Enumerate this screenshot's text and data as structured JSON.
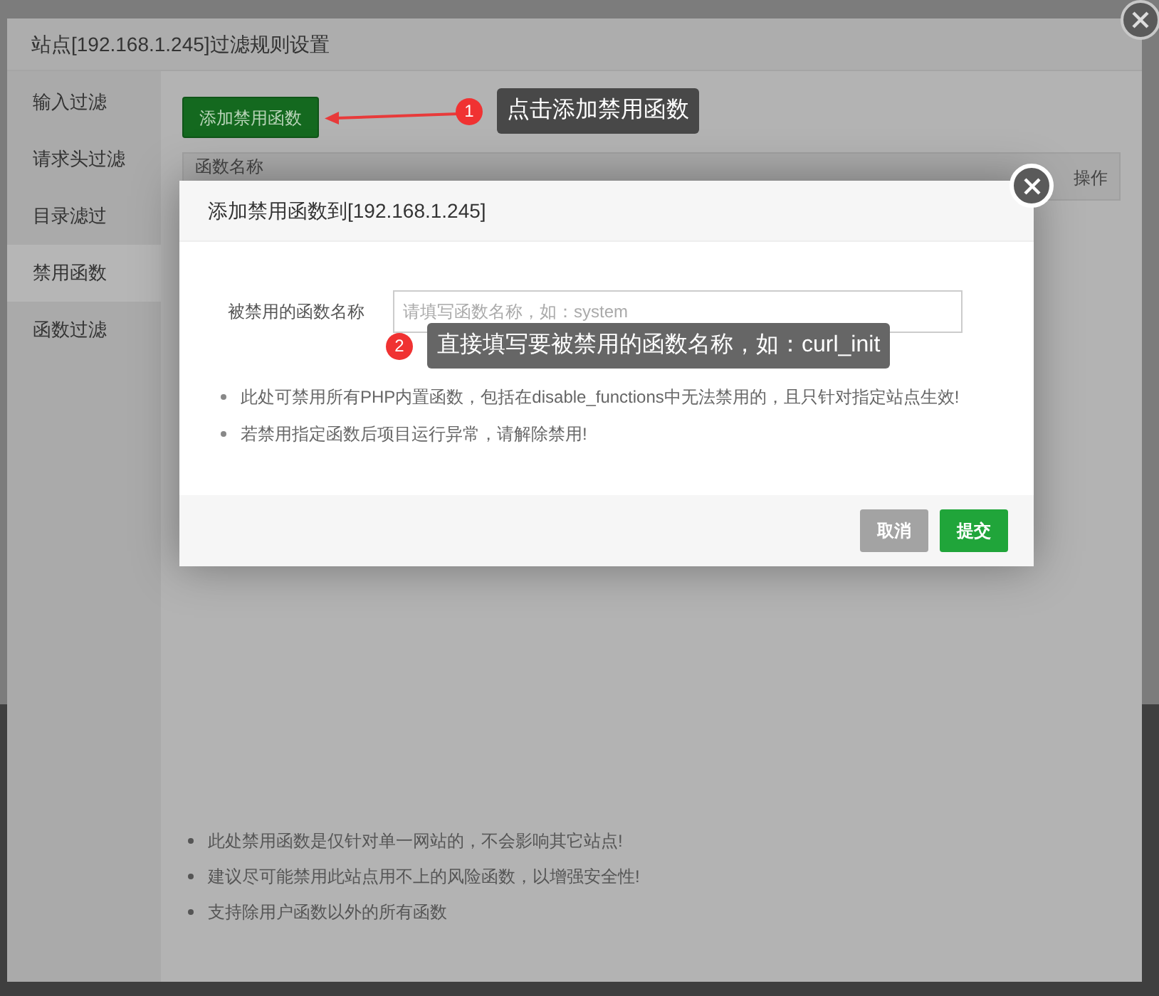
{
  "outer_dialog": {
    "title": "站点[192.168.1.245]过滤规则设置",
    "sidebar": {
      "items": [
        {
          "label": "输入过滤",
          "selected": false
        },
        {
          "label": "请求头过滤",
          "selected": false
        },
        {
          "label": "目录滤过",
          "selected": false
        },
        {
          "label": "禁用函数",
          "selected": true
        },
        {
          "label": "函数过滤",
          "selected": false
        }
      ]
    },
    "add_button": "添加禁用函数",
    "table": {
      "columns": [
        "函数名称",
        "操作"
      ]
    },
    "notes": [
      "此处禁用函数是仅针对单一网站的，不会影响其它站点!",
      "建议尽可能禁用此站点用不上的风险函数，以增强安全性!",
      "支持除用户函数以外的所有函数"
    ]
  },
  "modal": {
    "title": "添加禁用函数到[192.168.1.245]",
    "field": {
      "label": "被禁用的函数名称",
      "placeholder": "请填写函数名称，如：system"
    },
    "notes": [
      "此处可禁用所有PHP内置函数，包括在disable_functions中无法禁用的，且只针对指定站点生效!",
      "若禁用指定函数后项目运行异常，请解除禁用!"
    ],
    "buttons": [
      {
        "label": "取消",
        "kind": "cancel"
      },
      {
        "label": "提交",
        "kind": "submit"
      }
    ]
  },
  "annotations": [
    {
      "number": "1",
      "text": "点击添加禁用函数"
    },
    {
      "number": "2",
      "text": "直接填写要被禁用的函数名称，如：curl_init"
    }
  ]
}
